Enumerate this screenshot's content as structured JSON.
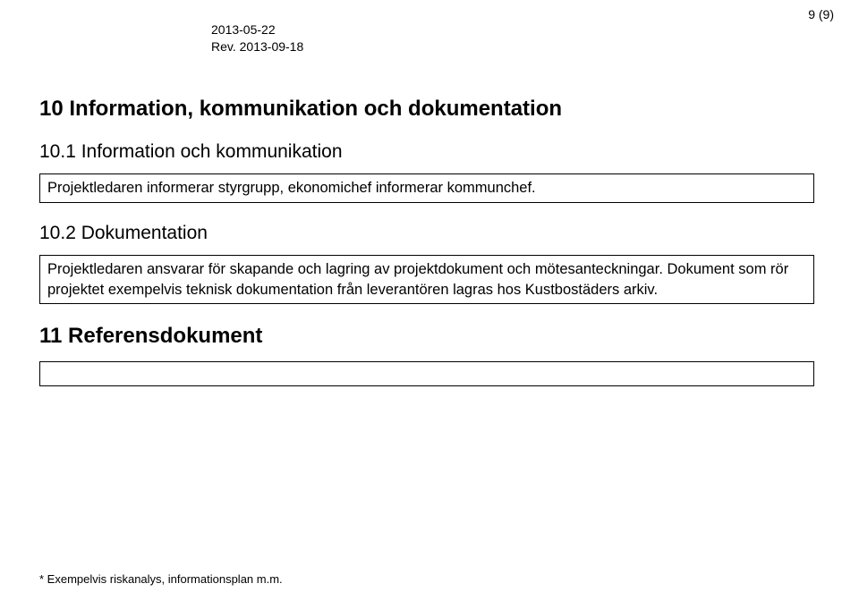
{
  "header": {
    "date1": "2013-05-22",
    "date2_prefix": "Rev. ",
    "date2": "2013-09-18",
    "page_label": "9 (9)"
  },
  "section10": {
    "heading": "10 Information, kommunikation och dokumentation",
    "sub1": {
      "heading": "10.1  Information och kommunikation",
      "box": "Projektledaren informerar styrgrupp, ekonomichef informerar kommunchef."
    },
    "sub2": {
      "heading": "10.2  Dokumentation",
      "box": "Projektledaren ansvarar för skapande och lagring av projektdokument och mötesanteckningar. Dokument som rör projektet exempelvis teknisk dokumentation från leverantören lagras hos Kustbostäders arkiv."
    }
  },
  "section11": {
    "heading": "11 Referensdokument",
    "box": ""
  },
  "footnote": "* Exempelvis riskanalys, informationsplan m.m."
}
